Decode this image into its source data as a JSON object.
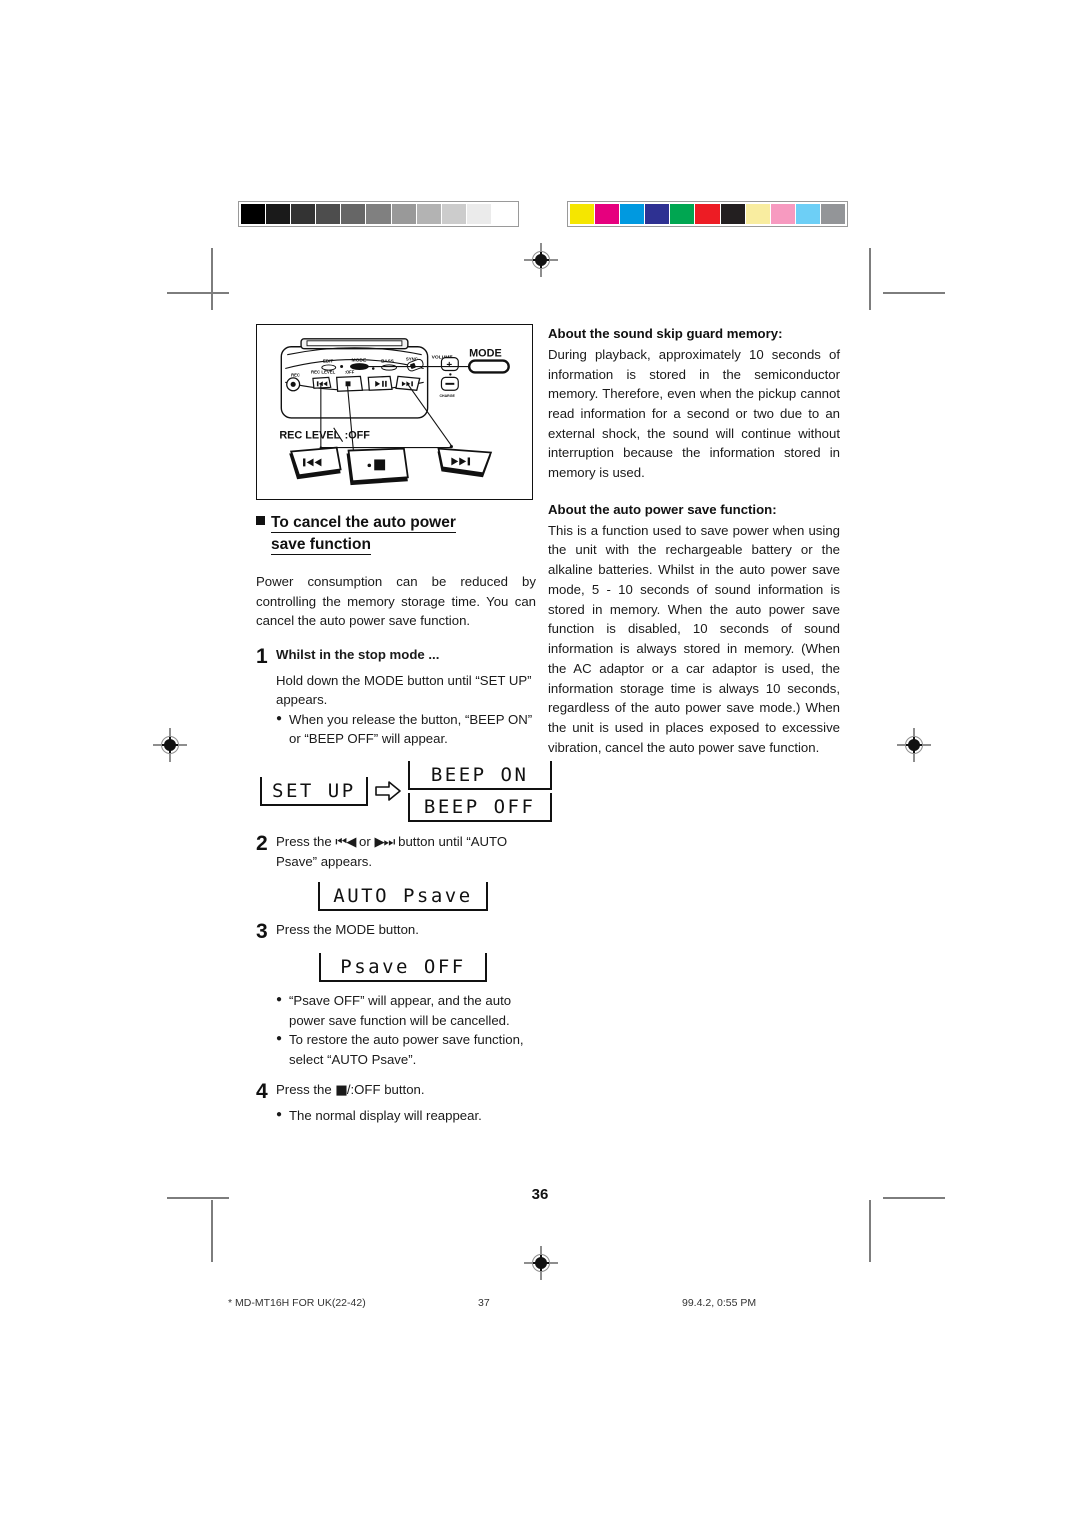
{
  "calibration": {
    "gray_bar": [
      "#000000",
      "#1a1a1a",
      "#333333",
      "#4d4d4d",
      "#666666",
      "#808080",
      "#999999",
      "#b3b3b3",
      "#cccccc",
      "#ebebeb",
      "#ffffff"
    ],
    "color_bar": [
      "#f5e600",
      "#e6007e",
      "#0099e0",
      "#2e3192",
      "#00a651",
      "#ed1c24",
      "#231f20",
      "#f9eda0",
      "#f79ac0",
      "#6dcff6",
      "#939598"
    ]
  },
  "illustration": {
    "panel_labels": {
      "edit": "EDIT",
      "mode": "MODE",
      "bass": "BASS",
      "sync": "SYNC",
      "volume": "VOLUME",
      "rec": "REC",
      "rec_level": "REC LEVEL",
      "off_small": ":OFF",
      "plus": "+",
      "minus": "–",
      "charge": "CHARGE"
    },
    "callouts": {
      "mode_button": "MODE",
      "rec_level": "REC LEVEL",
      "off": ":OFF"
    }
  },
  "left": {
    "heading_line1": "To cancel the auto power",
    "heading_line2": "save function",
    "intro": "Power consumption can be reduced by controlling the memory storage time. You can cancel the auto power save function.",
    "steps": [
      {
        "num": "1",
        "title": "Whilst in the stop mode ...",
        "body": "Hold down the MODE button until “SET UP” appears.",
        "bullets": [
          "When you release the button, “BEEP ON” or “BEEP OFF” will appear."
        ]
      },
      {
        "num": "2",
        "body_pre": "Press the ",
        "icon_prev": "⏮◀",
        "body_mid": " or ",
        "icon_next": "▶⏭",
        "body_post": " button  until “AUTO Psave” appears.",
        "bullets": []
      },
      {
        "num": "3",
        "body": "Press the MODE button.",
        "bullets": [
          "“Psave OFF” will appear, and the auto power save function will be cancelled.",
          "To restore the auto power save function, select “AUTO Psave”."
        ]
      },
      {
        "num": "4",
        "body_pre": "Press the ",
        "icon_stop": "■",
        "body_post": "/:OFF button.",
        "bullets": [
          "The normal display will reappear."
        ]
      }
    ],
    "lcd": {
      "set_up": "SET UP",
      "beep_on": "BEEP ON",
      "beep_off": "BEEP OFF",
      "auto_psave": "AUTO Psave",
      "psave_off": "Psave OFF"
    }
  },
  "right": {
    "section1_title": "About the sound skip guard memory:",
    "section1_body": "During playback, approximately 10 seconds of information is stored in the semiconductor memory. Therefore, even when the pickup cannot read information for a second or two due to an external shock, the sound will continue without interruption because the information stored in memory is used.",
    "section2_title": "About the auto power save function:",
    "section2_body": "This is a function used to save power when using the unit with the rechargeable battery or the alkaline batteries. Whilst in the auto power save mode, 5 - 10 seconds of sound information is stored in memory. When the auto power save function is disabled, 10 seconds of sound information is always stored in memory. (When the AC adaptor or a car adaptor is used, the information storage time is always 10 seconds, regardless of the auto power save mode.) When the unit is used in places exposed to excessive vibration, cancel the auto power save function."
  },
  "page_number": "36",
  "footer": {
    "left": "*  MD-MT16H FOR UK(22-42)",
    "middle": "37",
    "right": "99.4.2, 0:55 PM"
  }
}
